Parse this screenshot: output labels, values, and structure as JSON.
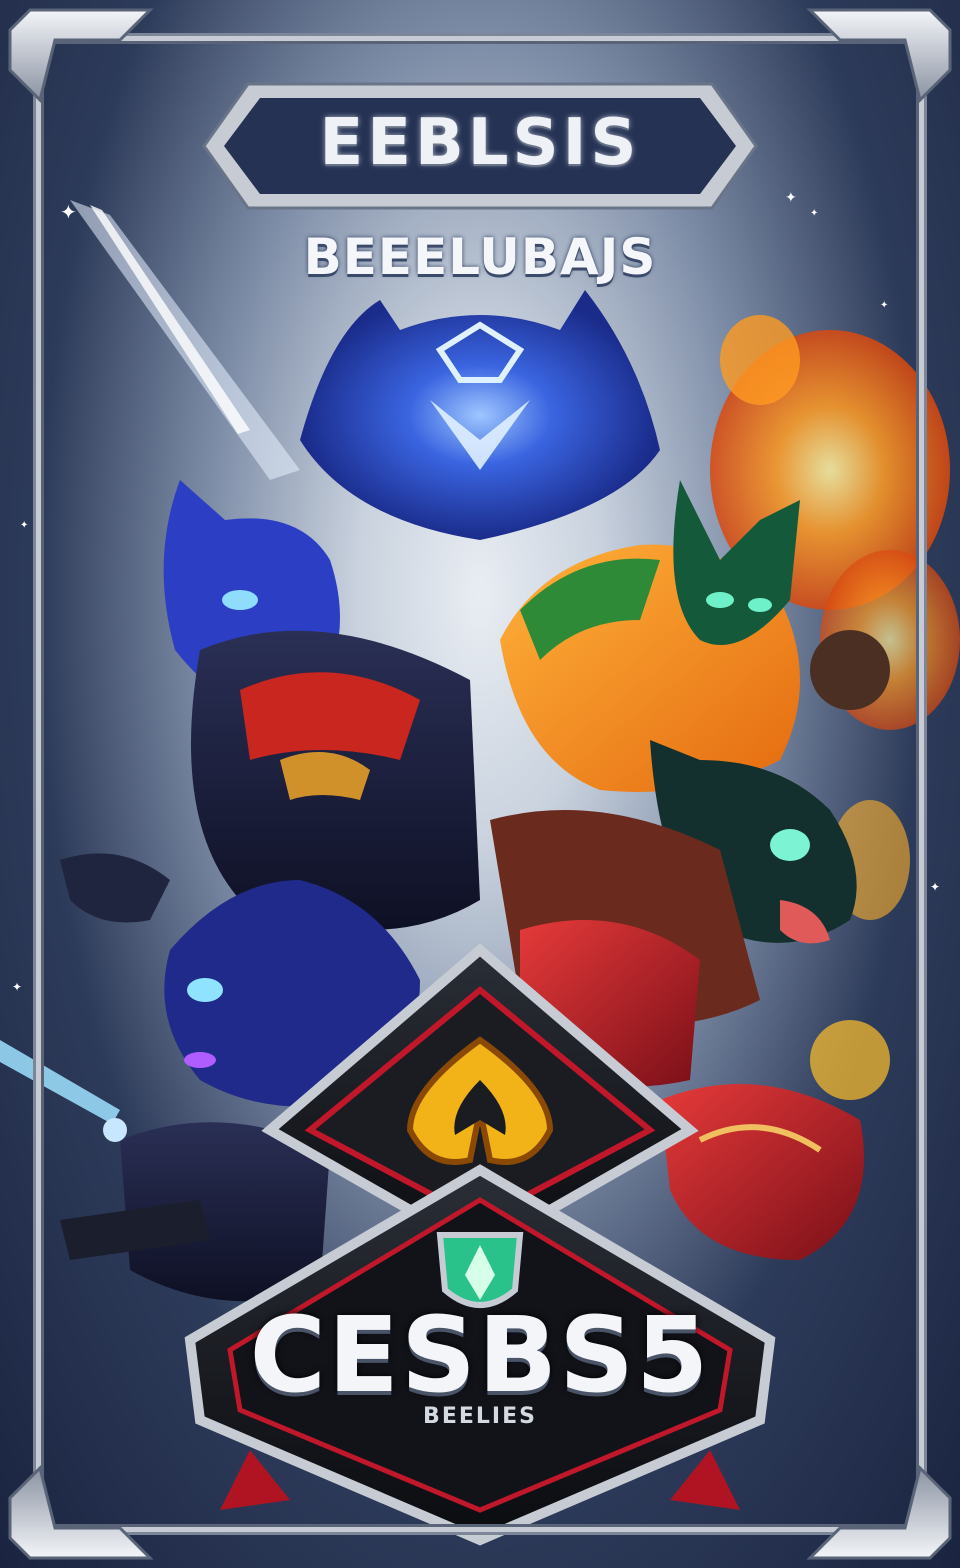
{
  "card": {
    "title": "EEBLSIS",
    "subtitle": "BEEELUBAJS",
    "badge_title": "CESBS5",
    "badge_subtitle": "BEELIES"
  },
  "colors": {
    "background_dark": "#1b2640",
    "frame_silver": "#c7ccd4",
    "glow_blue": "#3f7cff",
    "fire_orange": "#ff8a1c",
    "badge_red": "#c0182a",
    "badge_gold": "#f2b318",
    "emerald": "#29c28a"
  },
  "icons": {
    "crest_emblem": "gold-flame-crest-icon",
    "shield_emblem": "green-gem-shield-icon"
  }
}
